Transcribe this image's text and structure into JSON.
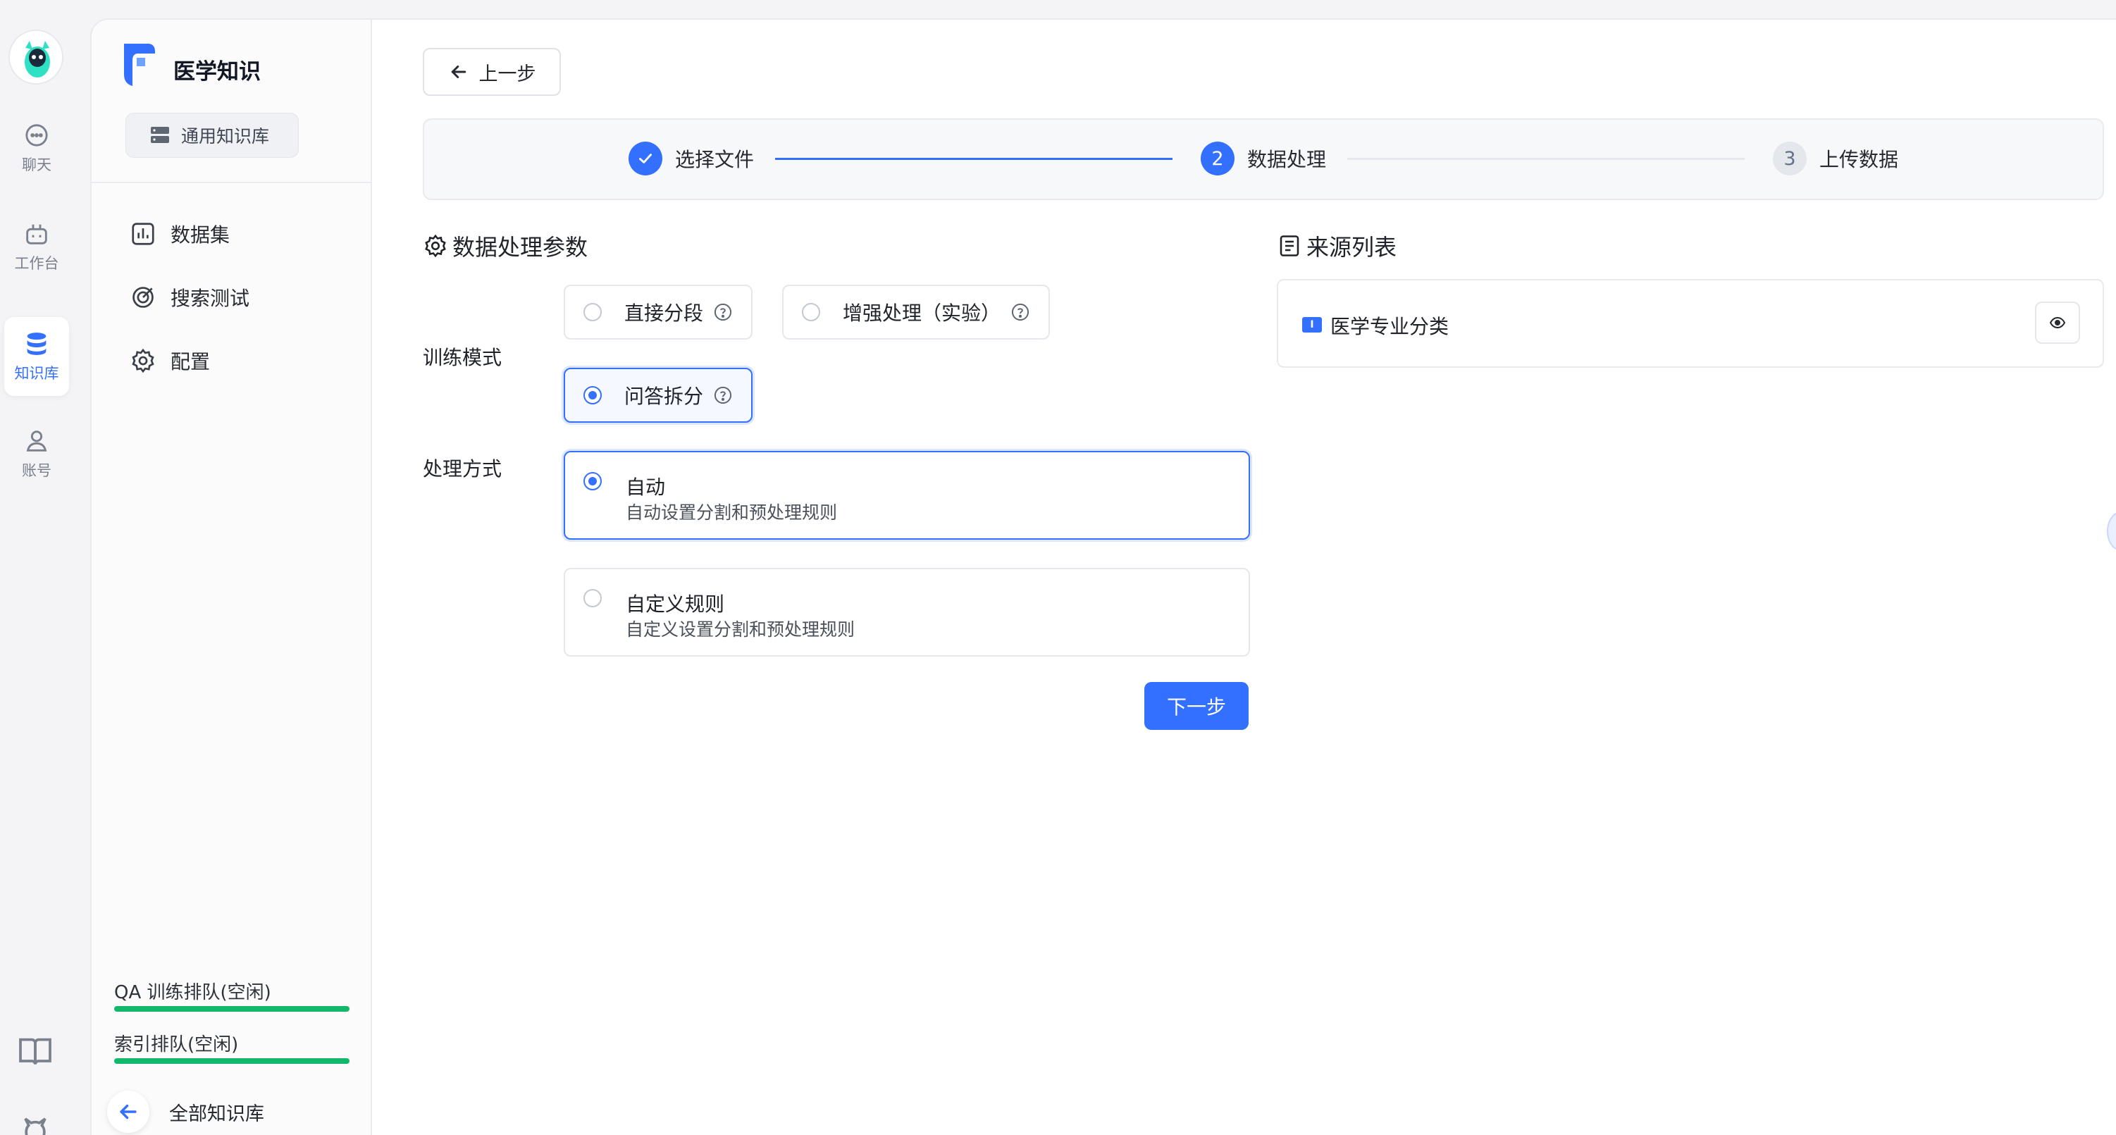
{
  "rail": {
    "items": [
      {
        "label": "聊天",
        "icon": "chat-icon"
      },
      {
        "label": "工作台",
        "icon": "robot-icon"
      },
      {
        "label": "知识库",
        "icon": "database-icon",
        "active": true
      },
      {
        "label": "账号",
        "icon": "user-icon"
      }
    ],
    "footer_icons": [
      "book-icon",
      "github-icon"
    ]
  },
  "sidebar": {
    "kb_title": "医学知识",
    "kb_type": "通用知识库",
    "nav": [
      {
        "label": "数据集",
        "icon": "chart-icon"
      },
      {
        "label": "搜索测试",
        "icon": "target-icon"
      },
      {
        "label": "配置",
        "icon": "gear-icon"
      }
    ],
    "queues": [
      {
        "label": "QA 训练排队(空闲)"
      },
      {
        "label": "索引排队(空闲)"
      }
    ],
    "back_all": "全部知识库"
  },
  "main": {
    "back_label": "上一步",
    "steps": [
      {
        "label": "选择文件",
        "status": "done"
      },
      {
        "label": "数据处理",
        "number": "2",
        "status": "active"
      },
      {
        "label": "上传数据",
        "number": "3",
        "status": "wait"
      }
    ],
    "params_title": "数据处理参数",
    "train_mode_label": "训练模式",
    "train_modes": [
      {
        "label": "直接分段",
        "selected": false
      },
      {
        "label": "增强处理（实验）",
        "selected": false
      },
      {
        "label": "问答拆分",
        "selected": true
      }
    ],
    "method_label": "处理方式",
    "methods": [
      {
        "title": "自动",
        "desc": "自动设置分割和预处理规则",
        "selected": true
      },
      {
        "title": "自定义规则",
        "desc": "自定义设置分割和预处理规则",
        "selected": false
      }
    ],
    "next_label": "下一步",
    "source_title": "来源列表",
    "sources": [
      {
        "name": "医学专业分类",
        "icon_text": "I"
      }
    ]
  },
  "colors": {
    "accent": "#3370ff",
    "queue_bar": "#12b76a"
  }
}
